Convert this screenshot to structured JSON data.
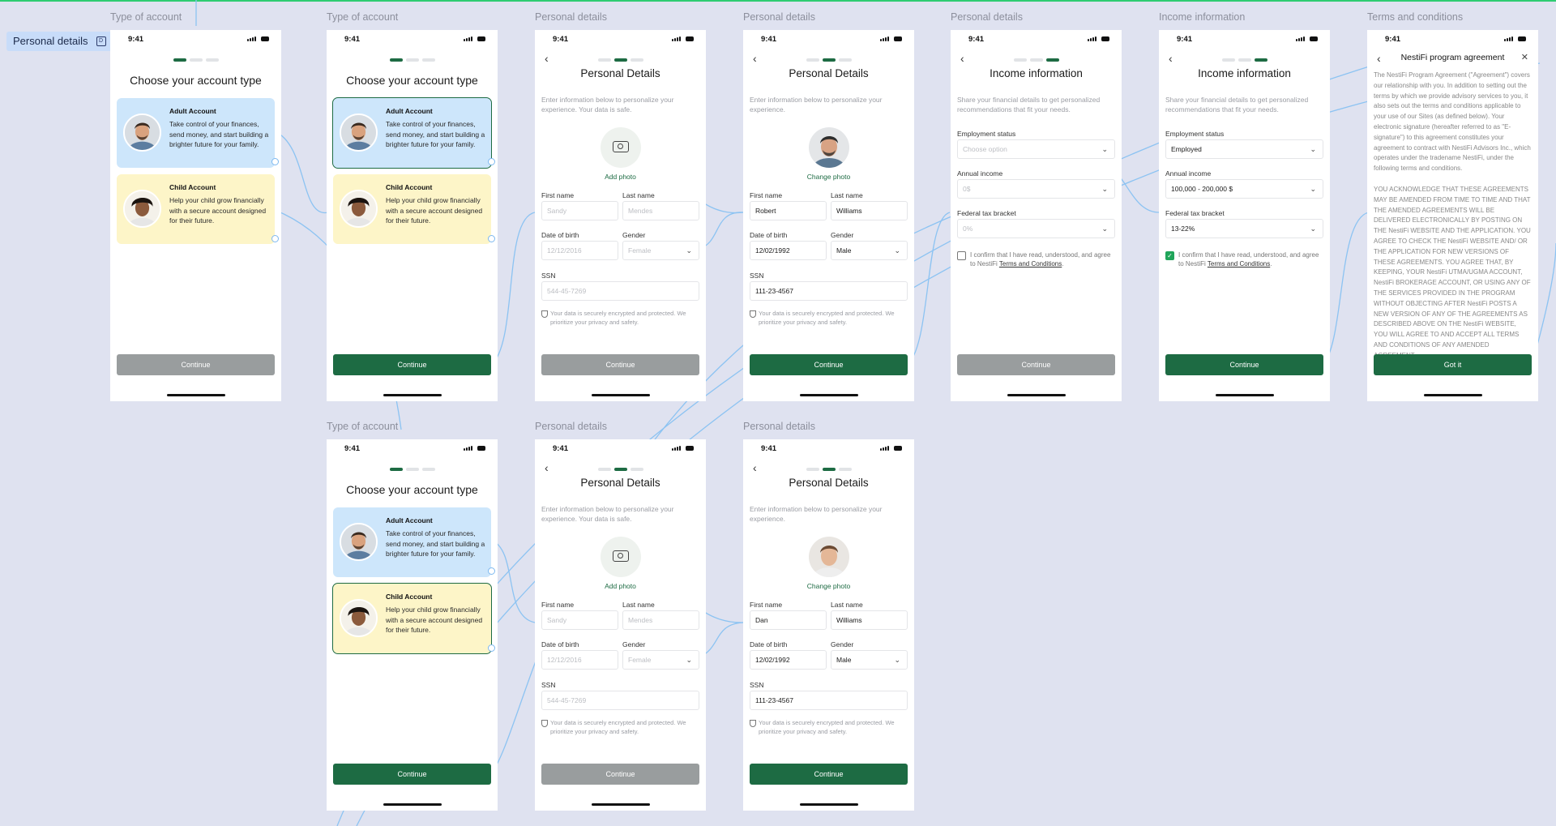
{
  "section": {
    "label": "Personal details"
  },
  "status_time": "9:41",
  "frames": [
    {
      "label": "Type of account",
      "kind": "account",
      "title": "Choose your account type",
      "selected": "none",
      "button": "Continue",
      "button_enabled": false
    },
    {
      "label": "Type of account",
      "kind": "account",
      "title": "Choose your account type",
      "selected": "adult",
      "button": "Continue",
      "button_enabled": true
    },
    {
      "label": "Personal details",
      "kind": "personal",
      "title": "Personal Details",
      "subtitle": "Enter information below to personalize your experience. Your data is safe.",
      "photo": "Add photo",
      "filled": false,
      "first_name": "Sandy",
      "last_name": "Mendes",
      "dob": "12/12/2016",
      "gender": "Female",
      "ssn": "544-45-7269",
      "button": "Continue",
      "button_enabled": false
    },
    {
      "label": "Personal details",
      "kind": "personal",
      "title": "Personal Details",
      "subtitle": "Enter information below to personalize your experience.",
      "photo": "Change photo",
      "filled": true,
      "first_name": "Robert",
      "last_name": "Williams",
      "dob": "12/02/1992",
      "gender": "Male",
      "ssn": "111-23-4567",
      "button": "Continue",
      "button_enabled": true
    },
    {
      "label": "Personal details",
      "kind": "income",
      "title": "Income information",
      "subtitle": "Share your financial details to get personalized recommendations that fit your needs.",
      "filled": false,
      "employment": "Choose option",
      "income": "0$",
      "tax": "0%",
      "checked": false,
      "button": "Continue",
      "button_enabled": false
    },
    {
      "label": "Income information",
      "kind": "income",
      "title": "Income information",
      "subtitle": "Share your financial details to get personalized recommendations that fit your needs.",
      "filled": true,
      "employment": "Employed",
      "income": "100,000 - 200,000 $",
      "tax": "13-22%",
      "checked": true,
      "button": "Continue",
      "button_enabled": true
    },
    {
      "label": "Terms and conditions",
      "kind": "terms",
      "title": "NestiFi program agreement",
      "button": "Got it"
    },
    {
      "label": "Type of account",
      "kind": "account",
      "title": "Choose your account type",
      "selected": "child",
      "button": "Continue",
      "button_enabled": true
    },
    {
      "label": "Personal details",
      "kind": "personal",
      "title": "Personal Details",
      "subtitle": "Enter information below to personalize your experience. Your data is safe.",
      "photo": "Add photo",
      "filled": false,
      "first_name": "Sandy",
      "last_name": "Mendes",
      "dob": "12/12/2016",
      "gender": "Female",
      "ssn": "544-45-7269",
      "button": "Continue",
      "button_enabled": false
    },
    {
      "label": "Personal details",
      "kind": "personal",
      "title": "Personal Details",
      "subtitle": "Enter information below to personalize your experience.",
      "photo": "Change photo",
      "filled": true,
      "first_name": "Dan",
      "last_name": "Williams",
      "dob": "12/02/1992",
      "gender": "Male",
      "ssn": "111-23-4567",
      "button": "Continue",
      "button_enabled": true
    }
  ],
  "account_cards": {
    "adult_title": "Adult Account",
    "adult_desc": "Take control of your finances, send money, and start building a brighter future for your family.",
    "child_title": "Child Account",
    "child_desc": "Help your child grow financially with a secure account designed for their future."
  },
  "personal_fields": {
    "first_name": "First name",
    "last_name": "Last name",
    "dob": "Date of birth",
    "gender": "Gender",
    "ssn": "SSN",
    "note": "Your data is securely encrypted and protected. We prioritize your privacy and safety."
  },
  "income_fields": {
    "employment": "Employment status",
    "income": "Annual income",
    "tax": "Federal tax bracket",
    "confirm_prefix": "I confirm that I have read, understood, and agree to NestiFi ",
    "confirm_link": "Terms and Conditions",
    "confirm_suffix": "."
  },
  "terms": {
    "p1": "The NestiFi Program Agreement (\"Agreement\") covers our relationship with you. In addition to setting out the terms by which we provide advisory services to you, it also sets out the terms and conditions applicable to your use of our Sites (as defined below). Your electronic signature (hereafter referred to as \"E-signature\") to this agreement constitutes your agreement to contract with NestiFi Advisors Inc., which operates under the tradename NestiFi, under the following terms and conditions.",
    "p2": "YOU ACKNOWLEDGE THAT THESE AGREEMENTS MAY BE AMENDED FROM TIME TO TIME AND THAT THE AMENDED AGREEMENTS WILL BE DELIVERED ELECTRONICALLY BY POSTING ON THE NestiFi WEBSITE AND THE APPLICATION. YOU AGREE TO CHECK THE NestiFi WEBSITE AND/ OR THE APPLICATION FOR NEW VERSIONS OF THESE AGREEMENTS. YOU AGREE THAT, BY KEEPING, YOUR NestiFi UTMA/UGMA ACCOUNT, NestiFi BROKERAGE ACCOUNT, OR USING ANY OF THE SERVICES PROVIDED IN THE PROGRAM WITHOUT OBJECTING AFTER NestiFi POSTS A NEW VERSION OF ANY OF THE AGREEMENTS AS DESCRIBED ABOVE ON THE NestiFi WEBSITE, YOU WILL AGREE TO AND ACCEPT ALL TERMS AND CONDITIONS OF ANY AMENDED AGREEMENT."
  },
  "colors": {
    "accent": "#1d6b43",
    "disabled": "#999d9e",
    "adult_card": "#cde6fb",
    "child_card": "#fdf5c8",
    "wire": "#7db8ef",
    "canvas": "#dfe2f0"
  }
}
